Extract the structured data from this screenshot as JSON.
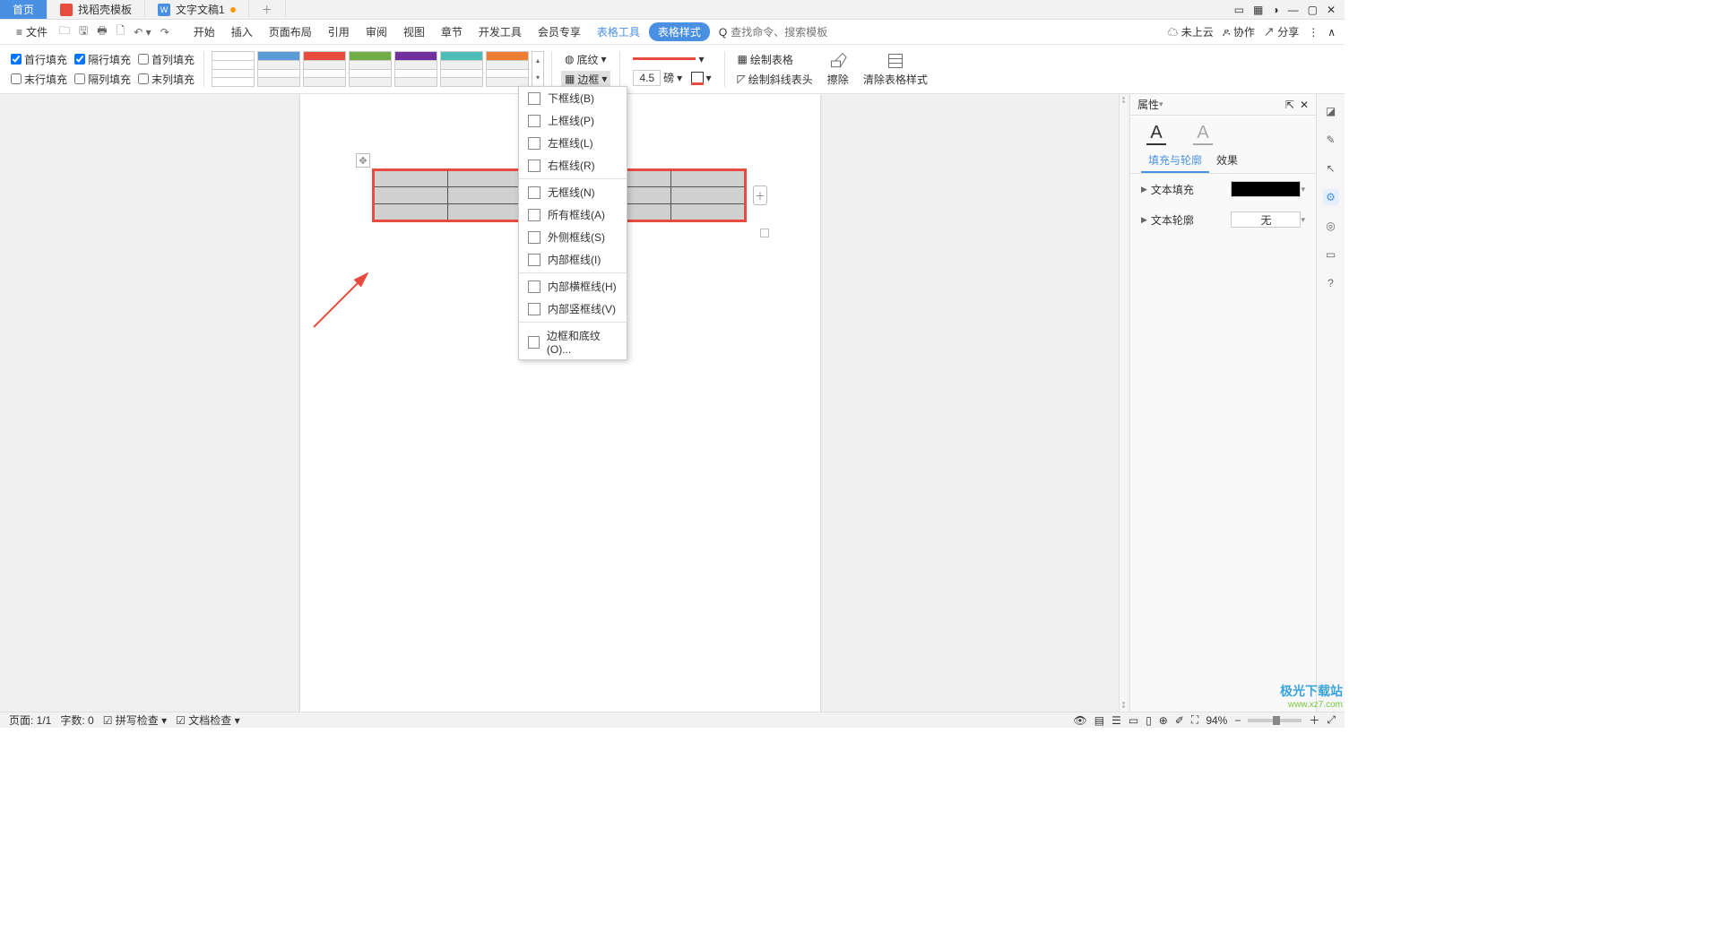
{
  "titlebar": {
    "home": "首页",
    "tab1": "找稻壳模板",
    "tab2": "文字文稿1"
  },
  "menubar": {
    "file": "文件",
    "tabs": [
      "开始",
      "插入",
      "页面布局",
      "引用",
      "审阅",
      "视图",
      "章节",
      "开发工具",
      "会员专享"
    ],
    "tool_tab": "表格工具",
    "active_tab": "表格样式",
    "search_placeholder": "查找命令、搜索模板",
    "search_icon": "Q",
    "cloud": "未上云",
    "coop": "协作",
    "share": "分享"
  },
  "ribbon": {
    "checks": {
      "c1": "首行填充",
      "c2": "隔行填充",
      "c3": "首列填充",
      "c4": "末行填充",
      "c5": "隔列填充",
      "c6": "末列填充"
    },
    "shading": "底纹",
    "border": "边框",
    "line_width": "4.5",
    "line_unit": "磅",
    "draw_table": "绘制表格",
    "draw_diag": "绘制斜线表头",
    "erase": "擦除",
    "clear_style": "清除表格样式"
  },
  "dropdown": {
    "items": [
      "下框线(B)",
      "上框线(P)",
      "左框线(L)",
      "右框线(R)",
      "无框线(N)",
      "所有框线(A)",
      "外侧框线(S)",
      "内部框线(I)",
      "内部横框线(H)",
      "内部竖框线(V)",
      "边框和底纹(O)..."
    ]
  },
  "proppanel": {
    "title": "属性",
    "tab_fill": "填充与轮廓",
    "tab_effect": "效果",
    "text_fill": "文本填充",
    "text_outline": "文本轮廓",
    "outline_none": "无"
  },
  "statusbar": {
    "page": "页面: 1/1",
    "words": "字数: 0",
    "spell": "拼写检查",
    "doc": "文档检查",
    "zoom": "94%"
  },
  "watermark": {
    "line1": "极光下载站",
    "line2": "www.xz7.com"
  }
}
